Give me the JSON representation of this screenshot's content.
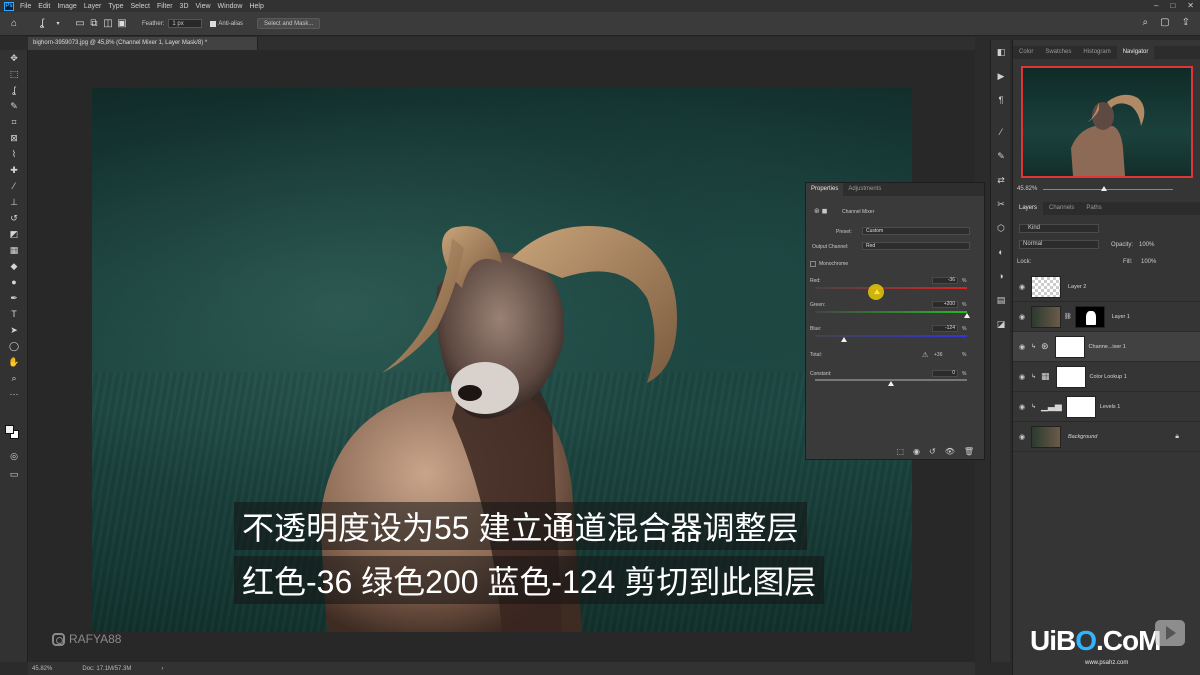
{
  "menu": {
    "logo": "Ps",
    "items": [
      "File",
      "Edit",
      "Image",
      "Layer",
      "Type",
      "Select",
      "Filter",
      "3D",
      "View",
      "Window",
      "Help"
    ],
    "window_controls": [
      "–",
      "□",
      "✕"
    ]
  },
  "options": {
    "feather_label": "Feather:",
    "feather_value": "1 px",
    "antialias_label": "Anti-alias",
    "select_mask_label": "Select and Mask..."
  },
  "document": {
    "tab_title": "bighorn-3959073.jpg @ 45,8% (Channel Mixer 1, Layer Mask/8) *"
  },
  "status": {
    "zoom": "45.82%",
    "doc": "Doc: 17.1M/57.3M"
  },
  "subtitles": {
    "line1": "不透明度设为55 建立通道混合器调整层",
    "line2": "红色-36 绿色200 蓝色-124 剪切到此图层"
  },
  "watermark": "RAFYA88",
  "properties": {
    "tabs": [
      "Properties",
      "Adjustments"
    ],
    "title": "Channel Mixer",
    "preset_label": "Preset:",
    "preset_value": "Custom",
    "output_label": "Output Channel:",
    "output_value": "Red",
    "monochrome_label": "Monochrome",
    "sliders": [
      {
        "name": "Red:",
        "value": "-36",
        "unit": "%",
        "level": -36
      },
      {
        "name": "Green:",
        "value": "+200",
        "unit": "%",
        "level": 200
      },
      {
        "name": "Blue:",
        "value": "-124",
        "unit": "%",
        "level": -124
      }
    ],
    "total_label": "Total:",
    "total_value": "+36",
    "total_unit": "%",
    "constant_label": "Constant:",
    "constant_value": "0",
    "constant_unit": "%"
  },
  "panel_tabs_top": [
    "Color",
    "Swatches",
    "Histogram",
    "Navigator"
  ],
  "navigator": {
    "zoom": "45.82%"
  },
  "layers_panel": {
    "tabs": [
      "Layers",
      "Channels",
      "Paths"
    ],
    "filter_label": "Kind",
    "blend_mode": "Normal",
    "opacity_label": "Opacity:",
    "opacity_value": "100%",
    "lock_label": "Lock:",
    "fill_label": "Fill:",
    "fill_value": "100%",
    "layers": [
      {
        "name": "Layer 2"
      },
      {
        "name": "Layer 1"
      },
      {
        "name": "Channe...ixer 1"
      },
      {
        "name": "Color Lookup 1"
      },
      {
        "name": "Levels 1"
      },
      {
        "name": "Background"
      }
    ]
  },
  "brand": {
    "logo_a": "UiB",
    "logo_o": "O",
    "logo_b": ".CoM",
    "url": "www.psahz.com"
  },
  "colors": {
    "accent": "#31a8ff",
    "nav_frame": "#e03535",
    "highlight": "#ffdc00"
  }
}
